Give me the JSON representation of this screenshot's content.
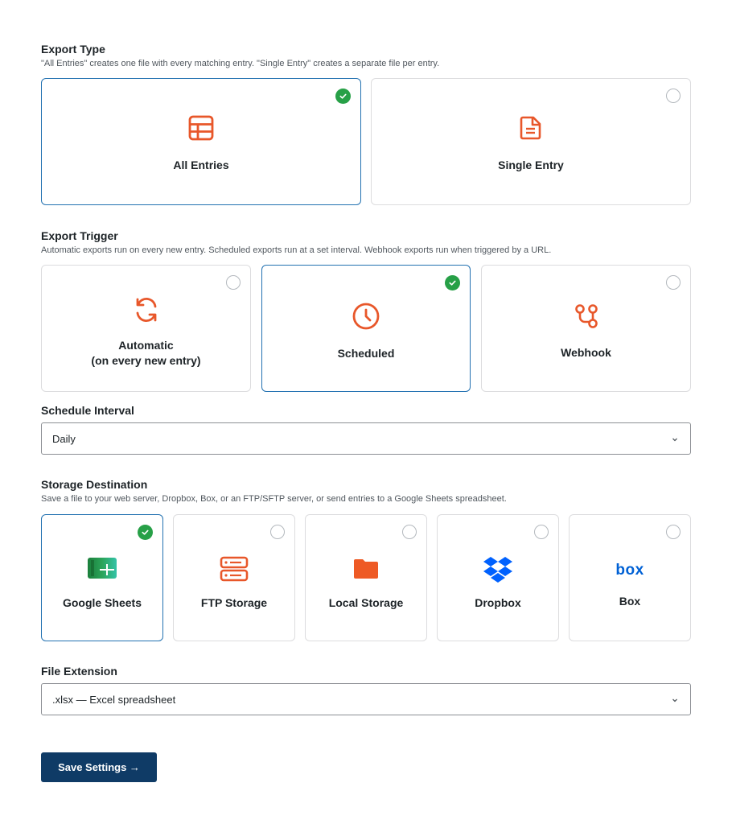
{
  "export_type": {
    "title": "Export Type",
    "description": "\"All Entries\" creates one file with every matching entry. \"Single Entry\" creates a separate file per entry.",
    "options": [
      {
        "label": "All Entries",
        "icon": "table-icon",
        "selected": true
      },
      {
        "label": "Single Entry",
        "icon": "document-icon",
        "selected": false
      }
    ]
  },
  "export_trigger": {
    "title": "Export Trigger",
    "description": "Automatic exports run on every new entry. Scheduled exports run at a set interval. Webhook exports run when triggered by a URL.",
    "options": [
      {
        "label": "Automatic\n(on every new entry)",
        "icon": "refresh-icon",
        "selected": false
      },
      {
        "label": "Scheduled",
        "icon": "clock-icon",
        "selected": true
      },
      {
        "label": "Webhook",
        "icon": "webhook-icon",
        "selected": false
      }
    ]
  },
  "schedule_interval": {
    "title": "Schedule Interval",
    "value": "Daily"
  },
  "storage_destination": {
    "title": "Storage Destination",
    "description": "Save a file to your web server, Dropbox, Box, or an FTP/SFTP server, or send entries to a Google Sheets spreadsheet.",
    "options": [
      {
        "label": "Google Sheets",
        "icon": "google-sheets-icon",
        "selected": true
      },
      {
        "label": "FTP Storage",
        "icon": "server-icon",
        "selected": false
      },
      {
        "label": "Local Storage",
        "icon": "folder-icon",
        "selected": false
      },
      {
        "label": "Dropbox",
        "icon": "dropbox-icon",
        "selected": false
      },
      {
        "label": "Box",
        "icon": "box-logo",
        "selected": false
      }
    ],
    "box_logo_text": "box"
  },
  "file_extension": {
    "title": "File Extension",
    "value": ".xlsx — Excel spreadsheet"
  },
  "save_button": {
    "label": "Save Settings →"
  },
  "colors": {
    "accent_orange": "#e8572a",
    "selected_border": "#2271b1",
    "check_green": "#27a047",
    "button_navy": "#0f3b66",
    "dropbox_blue": "#0061fe",
    "box_blue": "#0061d5"
  }
}
